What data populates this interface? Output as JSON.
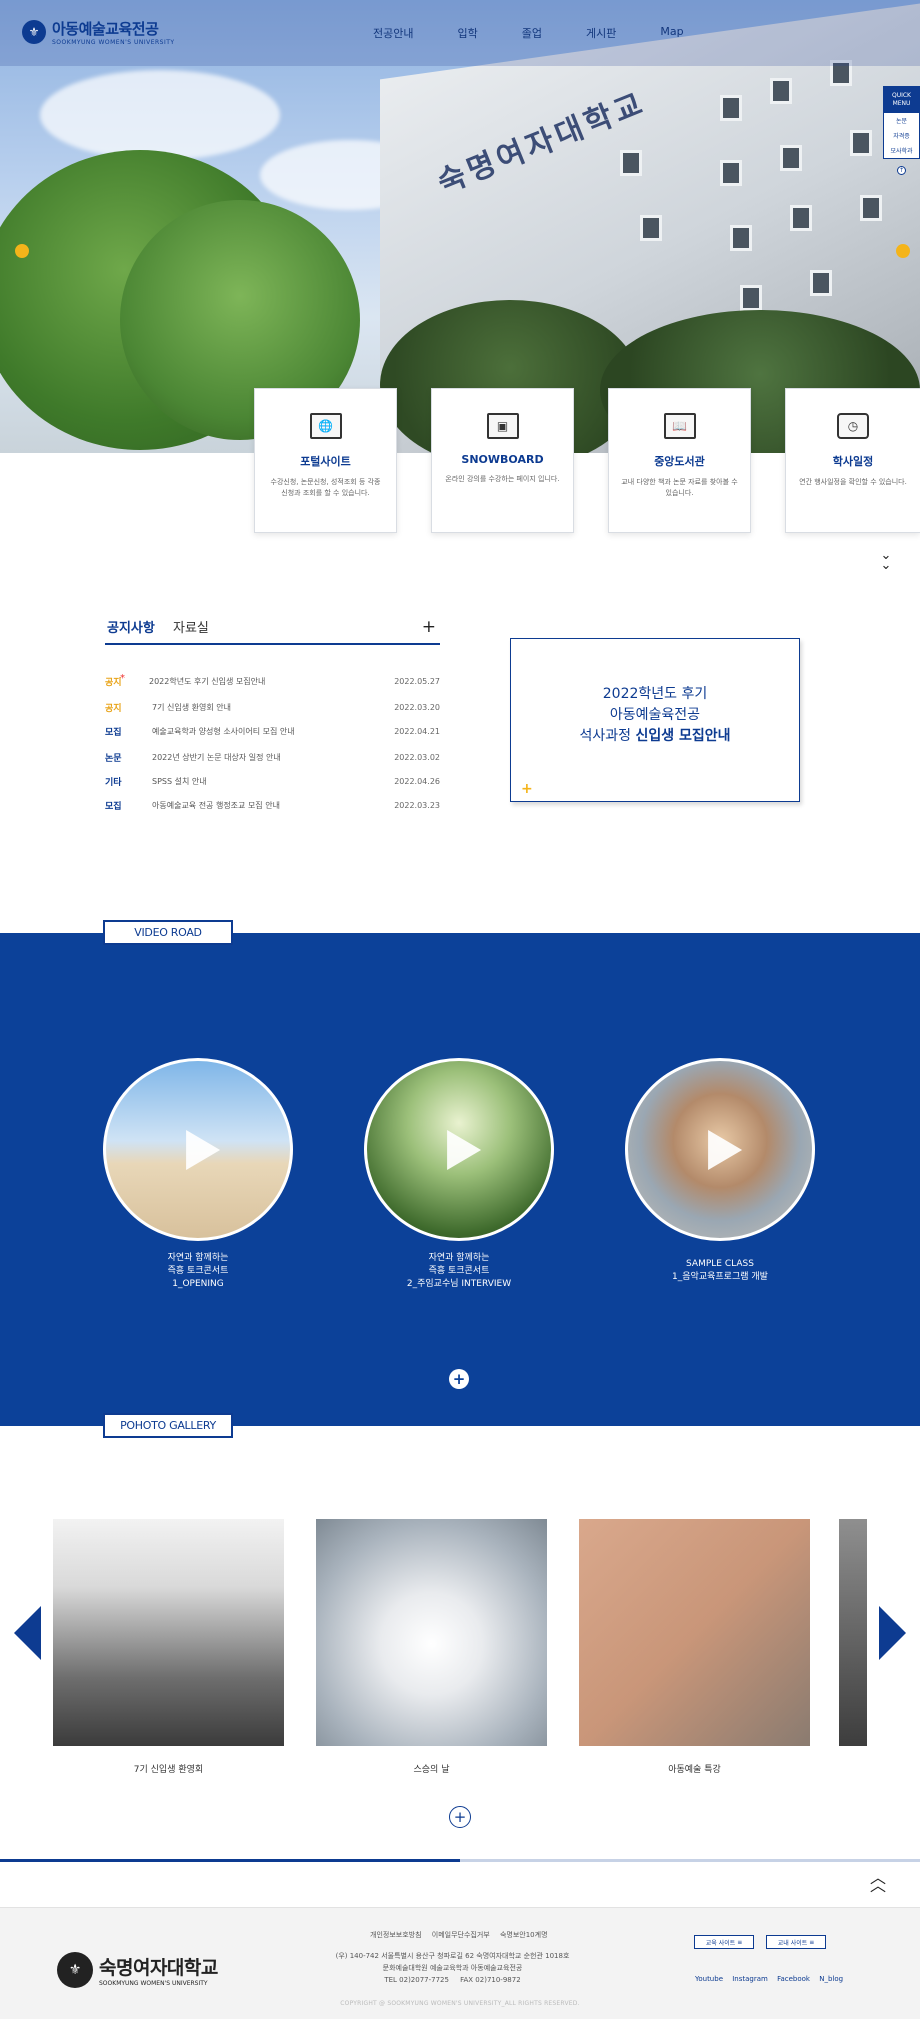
{
  "header": {
    "logo_title": "아동예술교육전공",
    "logo_sub": "SOOKMYUNG WOMEN'S UNIVERSITY",
    "logo_emblem": "⚜",
    "nav": [
      "전공안내",
      "입학",
      "졸업",
      "게시판",
      "Map"
    ]
  },
  "hero": {
    "building_sign": "숙명여자대학교"
  },
  "quick_menu": {
    "title_line1": "QUICK",
    "title_line2": "MENU",
    "items": [
      "논문",
      "자격증",
      "모사학과"
    ]
  },
  "service_cards": [
    {
      "title": "포털사이트",
      "desc": "수강신청, 논문신청, 성적조회 등 각종 신청과 조회를 할 수 있습니다.",
      "icon": "www-icon"
    },
    {
      "title": "SNOWBOARD",
      "desc": "온라인 강의를 수강하는 페이지 입니다.",
      "icon": "online-class-icon"
    },
    {
      "title": "중앙도서관",
      "desc": "교내 다양한 책과 논문 자료를 찾아볼 수 있습니다.",
      "icon": "book-icon"
    },
    {
      "title": "학사일정",
      "desc": "연간 행사일정을 확인할 수 있습니다.",
      "icon": "clock-icon"
    }
  ],
  "notice": {
    "tab_active": "공지사항",
    "tab_other": "자료실",
    "more": "+",
    "rows": [
      {
        "cat": "공지",
        "title": "2022학년도 후기 신입생 모집안내",
        "date": "2022.05.27",
        "gold": true,
        "star": true
      },
      {
        "cat": "공지",
        "title": "7기 신입생 환영회 안내",
        "date": "2022.03.20",
        "gold": true,
        "star": false
      },
      {
        "cat": "모집",
        "title": "예술교육학과 양성형 소사이어티 모집 안내",
        "date": "2022.04.21",
        "gold": false,
        "star": false
      },
      {
        "cat": "논문",
        "title": "2022년 상반기 논문 대상자 일정 안내",
        "date": "2022.03.02",
        "gold": false,
        "star": false
      },
      {
        "cat": "기타",
        "title": "SPSS 설치 안내",
        "date": "2022.04.26",
        "gold": false,
        "star": false
      },
      {
        "cat": "모집",
        "title": "아동예술교육 전공 행정조교 모집 안내",
        "date": "2022.03.23",
        "gold": false,
        "star": false
      }
    ],
    "star_glyph": "*"
  },
  "promo": {
    "line1": "2022학년도 후기",
    "line2": "아동예술육전공",
    "line3_prefix": "석사과정 ",
    "line3_strong": "신입생 모집안내",
    "plus": "+"
  },
  "video": {
    "label": "VIDEO ROAD",
    "items": [
      {
        "caption1": "자연과 함께하는",
        "caption2": "즉흥 토크콘서트",
        "caption3": "1_OPENING"
      },
      {
        "caption1": "자연과 함께하는",
        "caption2": "즉흥 토크콘서트",
        "caption3": "2_주임교수님 INTERVIEW"
      },
      {
        "caption1": "SAMPLE CLASS",
        "caption2": "1_음악교육프로그램 개발",
        "caption3": ""
      }
    ],
    "more": "+"
  },
  "gallery": {
    "label": "POHOTO GALLERY",
    "items": [
      {
        "caption": "7기 신입생 환영회"
      },
      {
        "caption": "스승의 날"
      },
      {
        "caption": "아동예술 특강"
      }
    ],
    "more": "+",
    "progress": 0.5
  },
  "footer": {
    "links": [
      "개인정보보호방침",
      "이메일무단수집거부",
      "숙명보안10계명"
    ],
    "address": "(우) 140-742 서울특별시 용산구 청파로길 62 숙명여자대학교 순헌관 1018호",
    "dept": "문화예술대학원 예술교육학과 아동예술교육전공",
    "tel": "TEL 02)2077-7725",
    "fax": "FAX 02)710-9872",
    "copyright": "COPYRIGHT @ SOOKMYUNG WOMEN'S UNIVERSITY_ALL RIGHTS RESERVED.",
    "site1": "교육 사이트",
    "site2": "교내 사이트",
    "sns": [
      "Youtube",
      "Instagram",
      "Facebook",
      "N_blog"
    ],
    "logo_name": "숙명여자대학교",
    "logo_sub": "SOOKMYUNG WOMEN'S UNIVERSITY",
    "menu_glyph": "≡"
  },
  "colors": {
    "primary": "#0d3b91",
    "band": "#0c4199",
    "accent": "#f4b41a"
  }
}
